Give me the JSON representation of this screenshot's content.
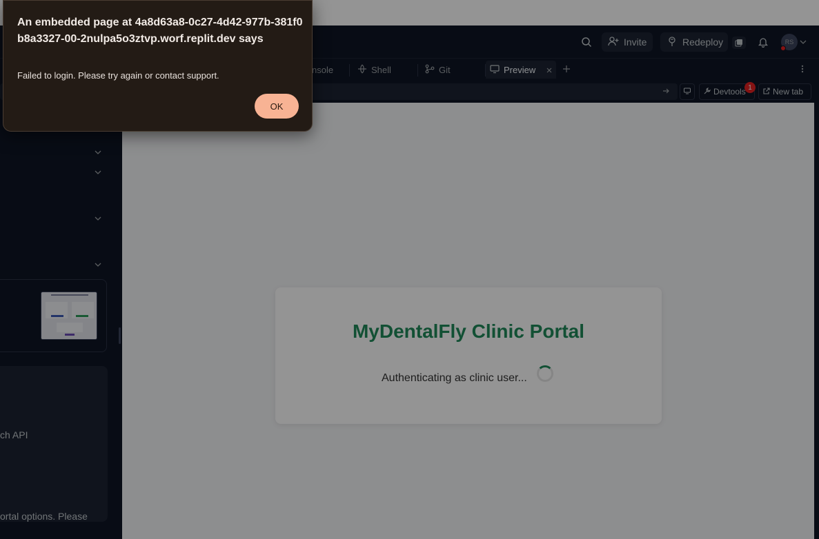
{
  "header": {
    "invite_label": "Invite",
    "redeploy_label": "Redeploy",
    "avatar_initials": "RS"
  },
  "tabs": [
    {
      "label": "nsole"
    },
    {
      "label": "Shell"
    },
    {
      "label": "Git"
    },
    {
      "label": "Preview"
    }
  ],
  "urlbar": {
    "devtools_label": "Devtools",
    "devtools_badge": "1",
    "new_tab_label": "New tab"
  },
  "left_panel": {
    "text_1": "ch API",
    "text_2": "ortal options. Please"
  },
  "preview": {
    "title": "MyDentalFly Clinic Portal",
    "status": "Authenticating as clinic user..."
  },
  "dialog": {
    "title": "An embedded page at 4a8d63a8-0c27-4d42-977b-381f0b8a3327-00-2nulpa5o3ztvp.worf.replit.dev says",
    "message": "Failed to login. Please try again or contact support.",
    "ok_label": "OK"
  },
  "colors": {
    "ide_background": "#0e1525",
    "brand_green": "#1f8a5a",
    "dialog_background": "#231b15",
    "ok_button": "#f8b394"
  }
}
